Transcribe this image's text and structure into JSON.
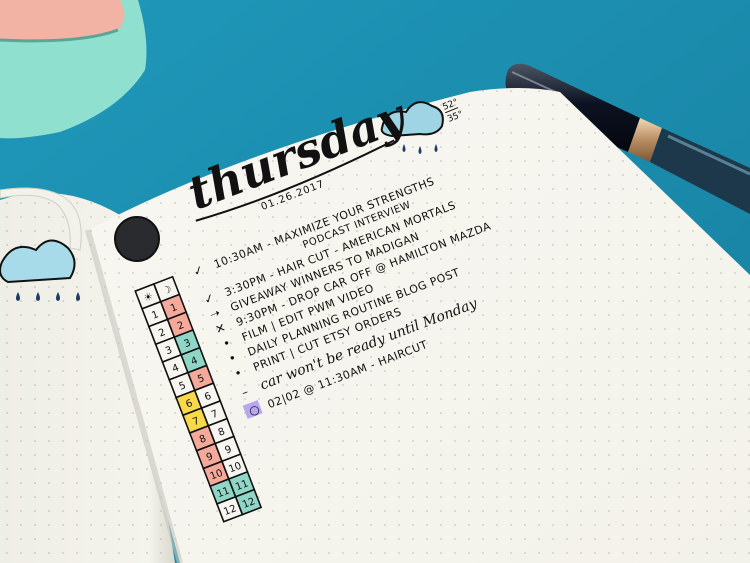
{
  "planner": {
    "day": "thursday",
    "date": "01.26.2017",
    "temperature": {
      "high": "52°",
      "low": "35°"
    },
    "tasks": [
      {
        "text": "10:30AM - MAXIMIZE YOUR STRENGTHS",
        "sub": "PODCAST INTERVIEW",
        "status": "done"
      },
      {
        "text": "3:30PM - HAIR CUT - AMERICAN MORTALS",
        "status": "done"
      },
      {
        "text": "GIVEAWAY WINNERS TO MADIGAN",
        "status": "migrated"
      },
      {
        "text": "9:30PM - DROP CAR OFF @ HAMILTON MAZDA",
        "status": "cancelled"
      },
      {
        "text": "FILM | EDIT PWM VIDEO",
        "status": "open"
      },
      {
        "text": "DAILY PLANNING ROUTINE BLOG POST",
        "status": "open"
      },
      {
        "text": "PRINT | CUT ETSY ORDERS",
        "status": "open"
      },
      {
        "text": "car won't be ready until Monday",
        "style": "script",
        "status": "note"
      },
      {
        "text": "02|02 @ 11:30AM - HAIRCUT",
        "status": "event"
      }
    ],
    "tracker": {
      "header_left": "☀",
      "header_right": "☽",
      "left_col": [
        "1",
        "2",
        "3",
        "4",
        "5",
        "6",
        "7",
        "8",
        "9",
        "10",
        "11",
        "12"
      ],
      "right_col": [
        "1",
        "2",
        "3",
        "4",
        "5",
        "6",
        "7",
        "8",
        "9",
        "10",
        "11",
        "12"
      ]
    }
  },
  "colors": {
    "background": "#1b8fb0",
    "paper": "#f6f5ee",
    "ink": "#141414",
    "pink": "#f4a99a",
    "teal": "#8fd6c6",
    "yellow": "#f7d94a",
    "highlight": "#b8a6f0"
  }
}
